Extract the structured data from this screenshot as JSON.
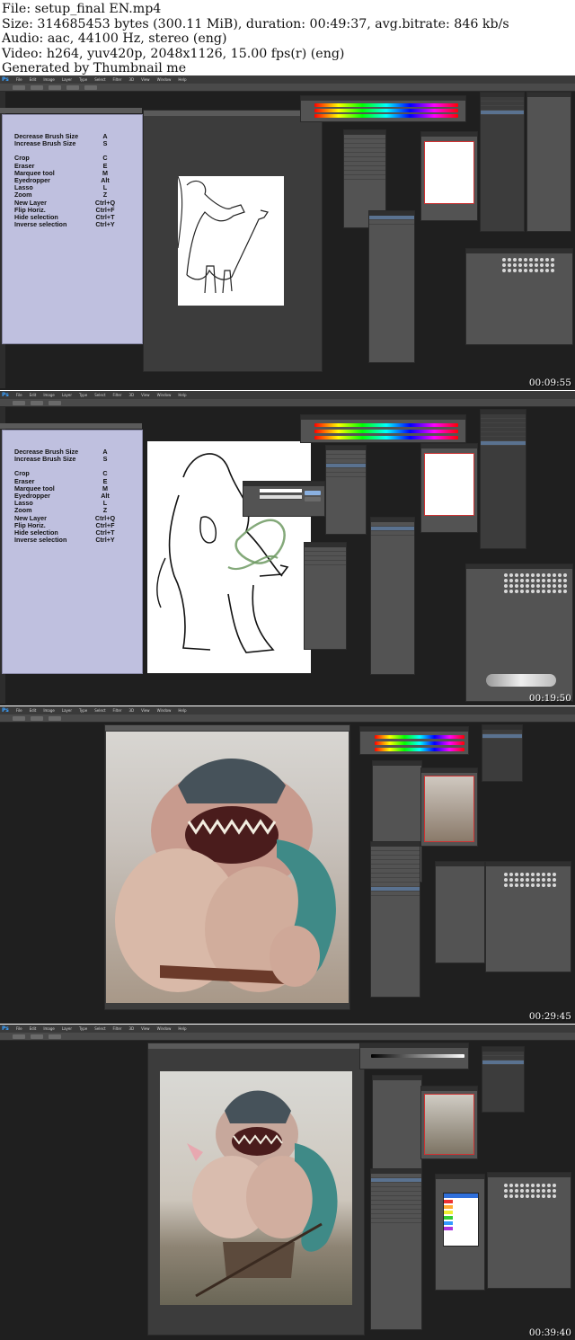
{
  "header": {
    "file": "File: setup_final EN.mp4",
    "size": "Size: 314685453 bytes (300.11 MiB), duration: 00:49:37, avg.bitrate: 846 kb/s",
    "audio": "Audio: aac, 44100 Hz, stereo (eng)",
    "video": "Video: h264, yuv420p, 2048x1126, 15.00 fps(r) (eng)",
    "generator": "Generated by Thumbnail me"
  },
  "frames": [
    {
      "timestamp": "00:09:55"
    },
    {
      "timestamp": "00:19:50"
    },
    {
      "timestamp": "00:29:45"
    },
    {
      "timestamp": "00:39:40"
    }
  ],
  "app": {
    "logo": "Ps",
    "menu": [
      "File",
      "Edit",
      "Image",
      "Layer",
      "Type",
      "Select",
      "Filter",
      "3D",
      "View",
      "Window",
      "Help"
    ]
  },
  "shortcuts": {
    "rows_top": [
      {
        "label": "Decrease Brush Size",
        "key": "A"
      },
      {
        "label": "Increase Brush Size",
        "key": "S"
      }
    ],
    "rows_bottom": [
      {
        "label": "Crop",
        "key": "C"
      },
      {
        "label": "Eraser",
        "key": "E"
      },
      {
        "label": "Marquee tool",
        "key": "M"
      },
      {
        "label": "Eyedropper",
        "key": "Alt"
      },
      {
        "label": "Lasso",
        "key": "L"
      },
      {
        "label": "Zoom",
        "key": "Z"
      },
      {
        "label": "New Layer",
        "key": "Ctrl+Q"
      },
      {
        "label": "Flip Horiz.",
        "key": "Ctrl+F"
      },
      {
        "label": "Hide selection",
        "key": "Ctrl+T"
      },
      {
        "label": "Inverse selection",
        "key": "Ctrl+Y"
      }
    ]
  },
  "colors": {
    "frame_bg": "#1f1f1f",
    "panel_bg": "#535353",
    "shortcut_bg": "#bfc0df",
    "ps_blue": "#39a0ff",
    "selection": "#5a7290"
  }
}
